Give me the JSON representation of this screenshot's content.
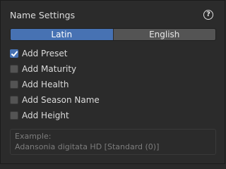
{
  "panel": {
    "title": "Name Settings",
    "help_icon": "question-circle-icon"
  },
  "segmented": {
    "options": [
      {
        "label": "Latin",
        "active": true
      },
      {
        "label": "English",
        "active": false
      }
    ],
    "accent_color": "#4772b3"
  },
  "checkboxes": [
    {
      "label": "Add Preset",
      "checked": true
    },
    {
      "label": "Add Maturity",
      "checked": false
    },
    {
      "label": "Add Health",
      "checked": false
    },
    {
      "label": "Add Season Name",
      "checked": false
    },
    {
      "label": "Add Height",
      "checked": false
    }
  ],
  "example": {
    "title": "Example:",
    "value": "Adansonia digitata HD [Standard (0)]"
  }
}
